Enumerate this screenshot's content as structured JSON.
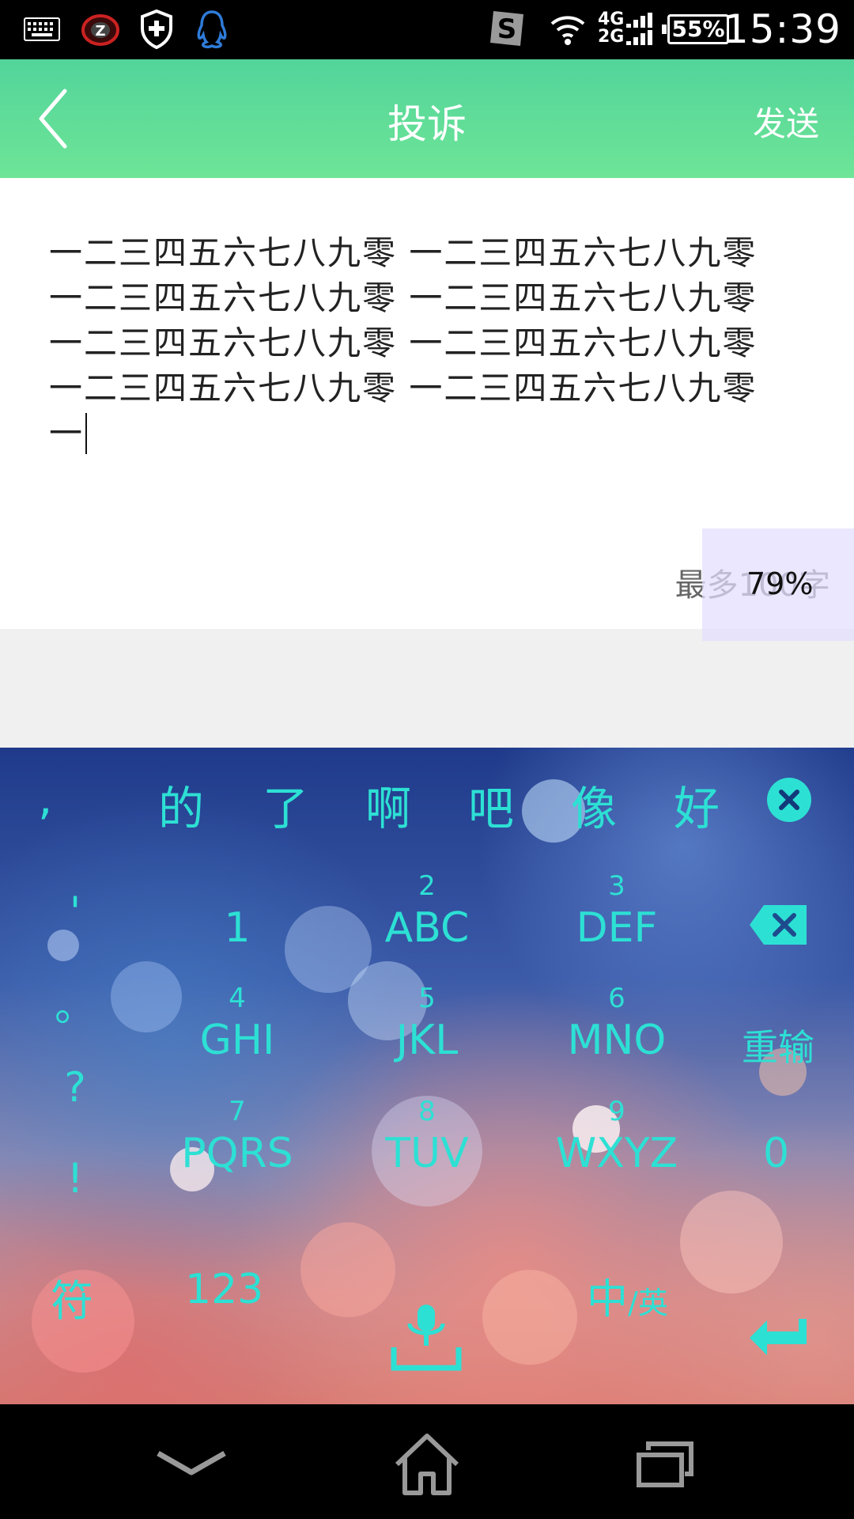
{
  "status_bar": {
    "time": "15:39",
    "battery": "55%",
    "network_top": "4G",
    "network_bottom": "2G",
    "icons": [
      "keyboard-icon",
      "alarm-icon",
      "shield-icon",
      "qq-icon",
      "sogou-icon",
      "wifi-icon",
      "signal-icon",
      "battery-icon"
    ]
  },
  "header": {
    "back_icon": "chevron-left-icon",
    "title": "投诉",
    "send_label": "发送"
  },
  "complaint": {
    "text": "一二三四五六七八九零 一二三四五六七八九零 一二三四五六七八九零 一二三四五六七八九零 一二三四五六七八九零 一二三四五六七八九零 一二三四五六七八九零 一二三四五六七八九零 一",
    "char_limit": "最多100字"
  },
  "zoom_overlay": {
    "text": "79%"
  },
  "keyboard": {
    "candidates": [
      ",",
      "的",
      "了",
      "啊",
      "吧",
      "像",
      "好"
    ],
    "left_symbols": [
      "'",
      "。",
      "?",
      "!"
    ],
    "keys": [
      {
        "num": "",
        "label": "1"
      },
      {
        "num": "2",
        "label": "ABC"
      },
      {
        "num": "3",
        "label": "DEF"
      },
      {
        "num": "4",
        "label": "GHI"
      },
      {
        "num": "5",
        "label": "JKL"
      },
      {
        "num": "6",
        "label": "MNO"
      },
      {
        "num": "7",
        "label": "PQRS"
      },
      {
        "num": "8",
        "label": "TUV"
      },
      {
        "num": "9",
        "label": "WXYZ"
      }
    ],
    "retype_label": "重输",
    "zero_label": "0",
    "symbols_label": "符",
    "numbers_label": "123",
    "lang_main": "中",
    "lang_sep": "/英",
    "accent_color": "#2de0d4"
  },
  "nav_bar": {
    "icons": [
      "back-chevron-icon",
      "home-icon",
      "recent-apps-icon"
    ]
  }
}
